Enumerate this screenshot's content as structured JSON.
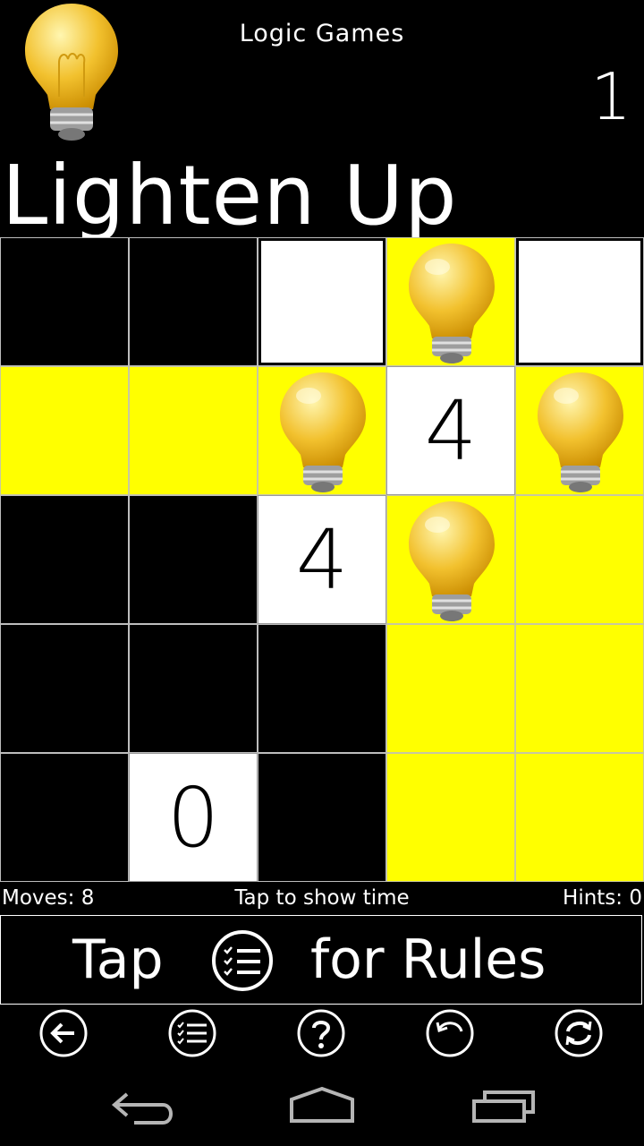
{
  "header": {
    "app_name": "Logic Games",
    "level": "1",
    "title": "Lighten Up"
  },
  "grid": {
    "rows": 5,
    "cols": 5,
    "cells": [
      [
        {
          "type": "black"
        },
        {
          "type": "black"
        },
        {
          "type": "white"
        },
        {
          "type": "lit",
          "bulb": true
        },
        {
          "type": "white"
        }
      ],
      [
        {
          "type": "lit"
        },
        {
          "type": "lit"
        },
        {
          "type": "lit",
          "bulb": true
        },
        {
          "type": "number",
          "value": "4"
        },
        {
          "type": "lit",
          "bulb": true
        }
      ],
      [
        {
          "type": "black"
        },
        {
          "type": "black"
        },
        {
          "type": "number",
          "value": "4"
        },
        {
          "type": "lit",
          "bulb": true
        },
        {
          "type": "lit"
        }
      ],
      [
        {
          "type": "black"
        },
        {
          "type": "black"
        },
        {
          "type": "black"
        },
        {
          "type": "lit"
        },
        {
          "type": "lit"
        }
      ],
      [
        {
          "type": "black"
        },
        {
          "type": "number",
          "value": "0"
        },
        {
          "type": "black"
        },
        {
          "type": "lit"
        },
        {
          "type": "lit"
        }
      ]
    ]
  },
  "status": {
    "moves": "Moves: 8",
    "timer": "Tap to show time",
    "hints": "Hints: 0"
  },
  "rules": {
    "prefix": "Tap",
    "suffix": "for Rules",
    "icon": "rules-list-icon"
  },
  "toolbar": [
    {
      "name": "back-button",
      "icon": "arrow-left-icon"
    },
    {
      "name": "rules-button",
      "icon": "rules-list-icon"
    },
    {
      "name": "help-button",
      "icon": "question-icon"
    },
    {
      "name": "undo-button",
      "icon": "undo-icon"
    },
    {
      "name": "restart-button",
      "icon": "refresh-icon"
    }
  ],
  "navbar": [
    {
      "name": "nav-back-button",
      "icon": "nav-back-icon"
    },
    {
      "name": "nav-home-button",
      "icon": "nav-home-icon"
    },
    {
      "name": "nav-recents-button",
      "icon": "nav-recents-icon"
    }
  ],
  "colors": {
    "lit": "#ffff00",
    "background": "#000000",
    "cell_white": "#ffffff"
  }
}
